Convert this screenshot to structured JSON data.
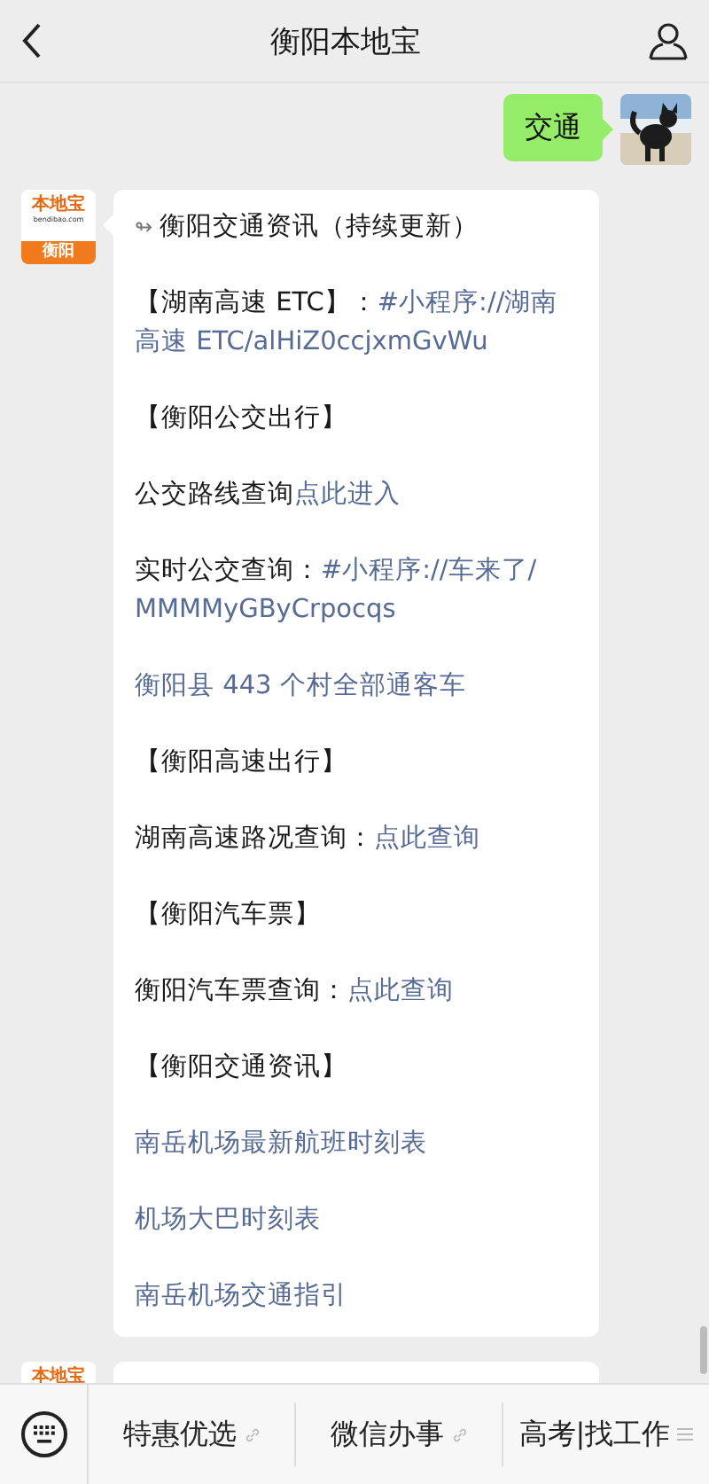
{
  "header": {
    "title": "衡阳本地宝"
  },
  "messages": [
    {
      "kind": "outgoing",
      "text": "交通"
    },
    {
      "kind": "incoming",
      "logo": {
        "brand": "本地宝",
        "domain": "bendibao.com",
        "city": "衡阳"
      },
      "lead": "↬",
      "paragraphs": [
        [
          {
            "text": "衡阳交通资讯（持续更新）",
            "link": false
          }
        ],
        [
          {
            "text": "【湖南高速 ETC】：",
            "link": false
          },
          {
            "text": "#小程序://湖南",
            "link": true
          },
          {
            "text": "高速 ETC/alHiZ0ccjxmGvWu",
            "link": true
          }
        ],
        [
          {
            "text": "【衡阳公交出行】",
            "link": false
          }
        ],
        [
          {
            "text": "公交路线查询",
            "link": false
          },
          {
            "text": "点此进入",
            "link": true
          }
        ],
        [
          {
            "text": "实时公交查询：",
            "link": false
          },
          {
            "text": "#小程序://车来了/",
            "link": true
          },
          {
            "text": "MMMMyGByCrpocqs",
            "link": true
          }
        ],
        [
          {
            "text": "衡阳县 443 个村全部通客车",
            "link": true
          }
        ],
        [
          {
            "text": "【衡阳高速出行】",
            "link": false
          }
        ],
        [
          {
            "text": "湖南高速路况查询：",
            "link": false
          },
          {
            "text": "点此查询",
            "link": true
          }
        ],
        [
          {
            "text": "【衡阳汽车票】",
            "link": false
          }
        ],
        [
          {
            "text": "衡阳汽车票查询：",
            "link": false
          },
          {
            "text": "点此查询",
            "link": true
          }
        ],
        [
          {
            "text": "【衡阳交通资讯】",
            "link": false
          }
        ],
        [
          {
            "text": "南岳机场最新航班时刻表",
            "link": true
          }
        ],
        [
          {
            "text": "机场大巴时刻表",
            "link": true
          }
        ],
        [
          {
            "text": "南岳机场交通指引",
            "link": true
          }
        ]
      ]
    },
    {
      "kind": "incoming",
      "logo": {
        "brand": "本地宝"
      }
    }
  ],
  "menu": [
    {
      "label": "特惠优选",
      "kind": "link"
    },
    {
      "label": "微信办事",
      "kind": "link"
    },
    {
      "label": "高考|找工作",
      "kind": "submenu"
    }
  ]
}
